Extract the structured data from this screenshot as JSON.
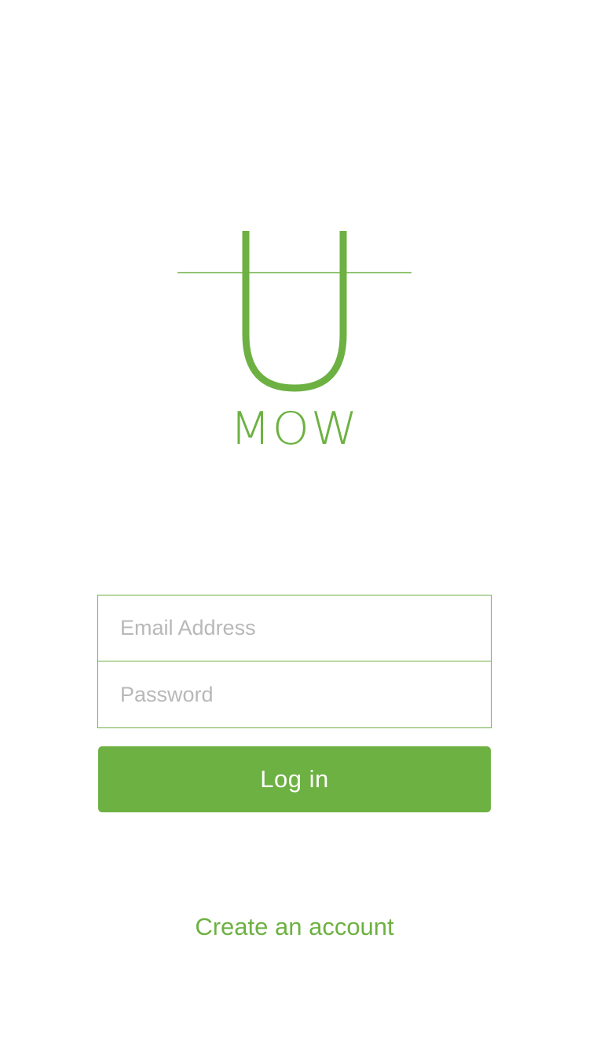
{
  "brand": {
    "name": "MOW",
    "color": "#6db142"
  },
  "login_form": {
    "email_placeholder": "Email Address",
    "email_value": "",
    "password_placeholder": "Password",
    "password_value": "",
    "submit_label": "Log in"
  },
  "footer": {
    "create_account_label": "Create an account"
  },
  "colors": {
    "accent": "#6db142",
    "placeholder": "#b8b8b8",
    "background": "#ffffff"
  }
}
